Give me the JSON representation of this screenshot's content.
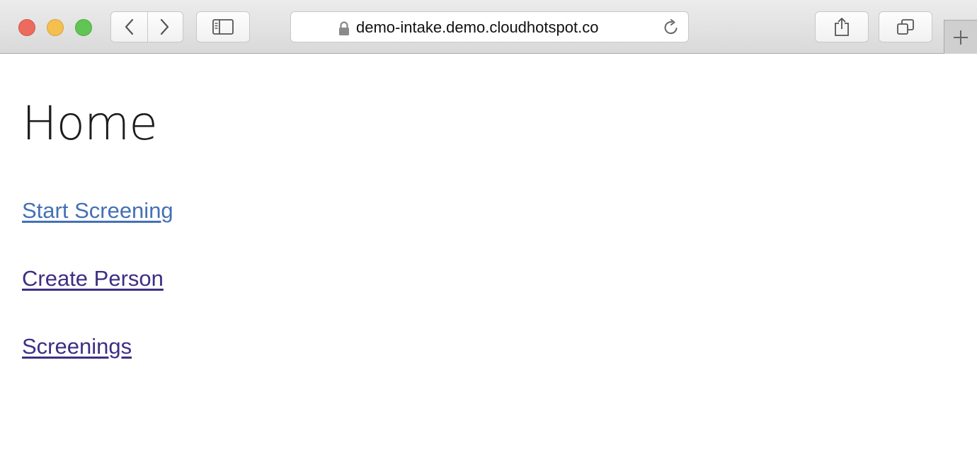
{
  "browser": {
    "url": "demo-intake.demo.cloudhotspot.co",
    "icons": {
      "close": "close-traffic-light",
      "minimize": "minimize-traffic-light",
      "zoom": "zoom-traffic-light",
      "back": "chevron-left-icon",
      "forward": "chevron-right-icon",
      "sidebar": "sidebar-icon",
      "lock": "lock-icon",
      "reload": "reload-icon",
      "share": "share-icon",
      "tabs": "tabs-icon",
      "new_tab": "plus-icon"
    },
    "colors": {
      "close": "#ec6a5e",
      "minimize": "#f4bf4f",
      "zoom": "#61c554"
    }
  },
  "page": {
    "title": "Home",
    "links": [
      {
        "label": "Start Screening",
        "color": "#4470b4"
      },
      {
        "label": "Create Person",
        "color": "#3f2e84"
      },
      {
        "label": "Screenings",
        "color": "#3f2e84"
      }
    ]
  }
}
